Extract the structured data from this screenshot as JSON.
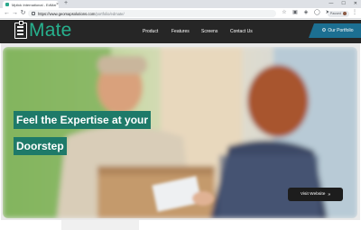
{
  "browser": {
    "tab_title": "Mplick International - EdMate",
    "tab_close": "×",
    "new_tab": "+",
    "window_controls": [
      "—",
      "☐",
      "✕"
    ],
    "nav_icons": [
      "arrow-left-icon",
      "arrow-right-icon",
      "reload-icon"
    ],
    "url_host": "https://www.geomapsolutions.com",
    "url_path": "/portfolio/edmate/",
    "profile_label": "Paused",
    "menu": "⋮"
  },
  "site": {
    "logo_text": "Mate",
    "nav": [
      "Product",
      "Features",
      "Screens",
      "Contact Us"
    ],
    "portfolio_label": "Our Portfolio",
    "portfolio_icon": "gear-icon"
  },
  "hero": {
    "headline_line1": "Feel the Expertise at your",
    "headline_line2": "Doorstep",
    "cta_label": "Visit Website",
    "cta_arrow": "»",
    "accent": "#1e7a69"
  },
  "colors": {
    "header_bg": "#262626",
    "brand": "#27b08d",
    "portfolio_bg": "#1c6f92"
  }
}
